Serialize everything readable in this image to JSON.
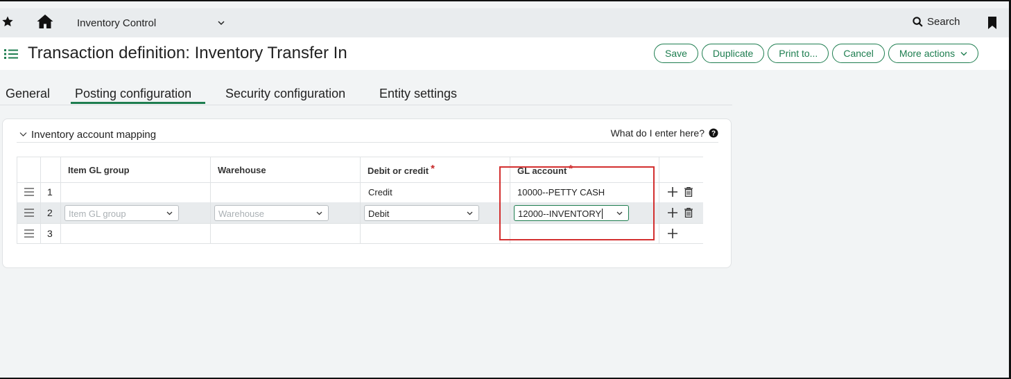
{
  "topbar": {
    "app_name": "Inventory Control",
    "search_label": "Search"
  },
  "page": {
    "title": "Transaction definition: Inventory Transfer In"
  },
  "actions": [
    {
      "label": "Save"
    },
    {
      "label": "Duplicate"
    },
    {
      "label": "Print to..."
    },
    {
      "label": "Cancel"
    },
    {
      "label": "More actions"
    }
  ],
  "tabs": [
    {
      "label": "General"
    },
    {
      "label": "Posting configuration",
      "active": true
    },
    {
      "label": "Security configuration"
    },
    {
      "label": "Entity settings"
    }
  ],
  "section": {
    "title": "Inventory account mapping",
    "help": "What do I enter here?"
  },
  "grid": {
    "columns": {
      "item_gl_group": "Item GL group",
      "warehouse": "Warehouse",
      "debit_credit": "Debit or credit",
      "gl_account": "GL account",
      "required_mark": "*"
    },
    "rows": [
      {
        "num": "1",
        "debit_credit": "Credit",
        "gl_account": "10000--PETTY CASH"
      },
      {
        "num": "2",
        "item_gl_group_placeholder": "Item GL group",
        "warehouse_placeholder": "Warehouse",
        "debit_credit": "Debit",
        "gl_account": "12000--INVENTORY"
      },
      {
        "num": "3"
      }
    ]
  },
  "colors": {
    "accent": "#1d7d4f",
    "required": "#c62828",
    "highlight": "#d32f2f"
  }
}
